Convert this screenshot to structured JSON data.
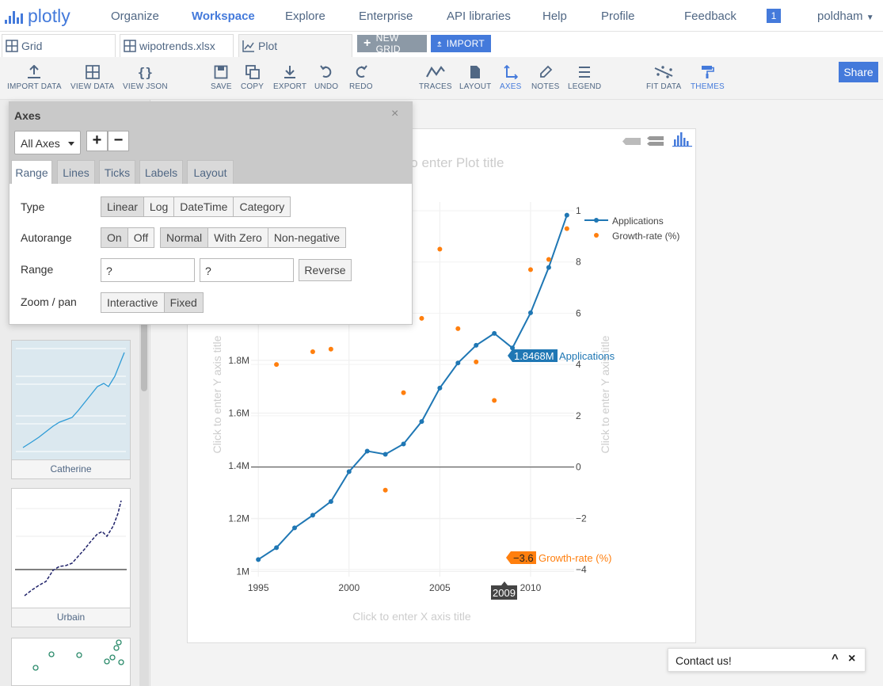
{
  "app": {
    "logo_text": "plotly"
  },
  "nav": {
    "items": [
      "Organize",
      "Workspace",
      "Explore",
      "Enterprise",
      "API libraries",
      "Help",
      "Profile",
      "Feedback"
    ],
    "notification_count": "1",
    "user": "poldham"
  },
  "tabs": {
    "grid": "Grid",
    "file": "wipotrends.xlsx",
    "plot": "Plot",
    "new_grid": "NEW GRID",
    "import": "IMPORT"
  },
  "toolbar": {
    "import_data": "IMPORT DATA",
    "view_data": "VIEW DATA",
    "view_json": "VIEW JSON",
    "save": "SAVE",
    "copy": "COPY",
    "export": "EXPORT",
    "undo": "UNDO",
    "redo": "REDO",
    "traces": "TRACES",
    "layout": "LAYOUT",
    "axes": "AXES",
    "notes": "NOTES",
    "legend": "LEGEND",
    "fit_data": "FIT DATA",
    "themes": "THEMES",
    "share": "Share"
  },
  "axes_panel": {
    "title": "Axes",
    "close": "×",
    "selector": "All Axes",
    "add": "+",
    "remove": "−",
    "tabs": [
      "Range",
      "Lines",
      "Ticks",
      "Labels",
      "Layout"
    ],
    "type_label": "Type",
    "type_options": [
      "Linear",
      "Log",
      "DateTime",
      "Category"
    ],
    "autorange_label": "Autorange",
    "autorange_onoff": [
      "On",
      "Off"
    ],
    "autorange_modes": [
      "Normal",
      "With Zero",
      "Non-negative"
    ],
    "range_label": "Range",
    "range_min": "?",
    "range_max": "?",
    "reverse": "Reverse",
    "zoom_label": "Zoom / pan",
    "zoom_options": [
      "Interactive",
      "Fixed"
    ]
  },
  "sidebar": {
    "thumbnails": [
      "Catherine",
      "Urbain"
    ]
  },
  "plot": {
    "title_placeholder": "Click to enter Plot title",
    "x_title_placeholder": "Click to enter X axis title",
    "y_title_placeholder": "Click to enter Y axis title",
    "y2_title_placeholder": "Click to enter Y axis title",
    "hover_applications_value": "1.8468M",
    "hover_applications_name": "Applications",
    "hover_growth_value": "−3.6",
    "hover_growth_name": "Growth-rate (%)",
    "hover_x": "2009"
  },
  "contact": {
    "text": "Contact us!",
    "minimize": "^",
    "close": "×"
  },
  "colors": {
    "accent": "#447adb",
    "applications": "#1f77b4",
    "growth": "#ff7f0e"
  },
  "chart_data": {
    "type": "line",
    "x": [
      1995,
      1996,
      1997,
      1998,
      1999,
      2000,
      2001,
      2002,
      2003,
      2004,
      2005,
      2006,
      2007,
      2008,
      2009,
      2010,
      2011,
      2012
    ],
    "series": [
      {
        "name": "Applications",
        "mode": "lines+markers",
        "axis": "y",
        "values": [
          1.045,
          1.09,
          1.165,
          1.213,
          1.265,
          1.378,
          1.456,
          1.444,
          1.483,
          1.568,
          1.695,
          1.79,
          1.857,
          1.902,
          1.8468,
          1.98,
          2.152,
          2.35
        ]
      },
      {
        "name": "Growth-rate (%)",
        "mode": "markers",
        "axis": "y2",
        "x": [
          1996,
          1998,
          1999,
          2002,
          2003,
          2004,
          2005,
          2006,
          2007,
          2008,
          2009,
          2010,
          2011,
          2012
        ],
        "values": [
          4.0,
          4.5,
          4.6,
          -0.9,
          2.9,
          5.8,
          8.5,
          5.4,
          4.1,
          2.6,
          -3.6,
          7.7,
          8.1,
          9.3
        ]
      }
    ],
    "x_ticks": [
      "1995",
      "2000",
      "2005",
      "2010"
    ],
    "y_ticks": [
      "1M",
      "1.2M",
      "1.4M",
      "1.6M",
      "1.8M"
    ],
    "y2_ticks": [
      "−4",
      "−2",
      "0",
      "2",
      "4",
      "6",
      "8",
      "1"
    ],
    "xlim": [
      1994.6,
      2012.4
    ],
    "ylim": [
      0.98,
      2.4
    ],
    "y2lim": [
      -4,
      10
    ],
    "legend": "top-right"
  }
}
